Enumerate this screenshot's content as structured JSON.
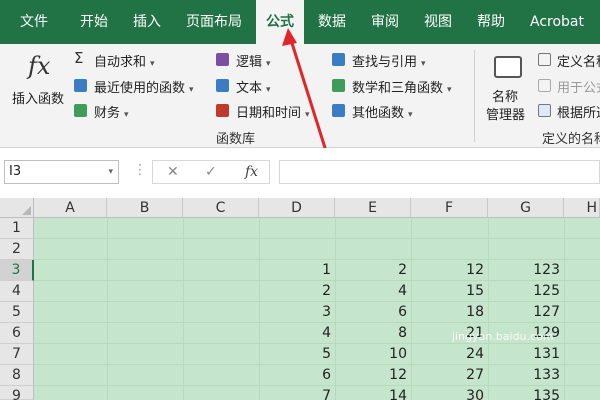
{
  "tabs": [
    "文件",
    "开始",
    "插入",
    "页面布局",
    "公式",
    "数据",
    "审阅",
    "视图",
    "帮助",
    "Acrobat"
  ],
  "active_tab": "公式",
  "ribbon": {
    "insert_function": "插入函数",
    "autosum": "自动求和",
    "recent": "最近使用的函数",
    "financial": "财务",
    "logical": "逻辑",
    "text": "文本",
    "datetime": "日期和时间",
    "lookup": "查找与引用",
    "math": "数学和三角函数",
    "more": "其他函数",
    "library_group": "函数库",
    "name_manager_line1": "名称",
    "name_manager_line2": "管理器",
    "define_name": "定义名称",
    "use_in_formula": "用于公式",
    "create_from_selection": "根据所选",
    "defined_names_group": "定义的名称",
    "fx_symbol": "fx",
    "sigma_symbol": "Σ"
  },
  "formula_bar": {
    "name_box": "I3",
    "cancel": "✕",
    "enter": "✓",
    "fx": "fx"
  },
  "grid": {
    "columns": [
      "A",
      "B",
      "C",
      "D",
      "E",
      "F",
      "G",
      "H"
    ],
    "rows": [
      "1",
      "2",
      "3",
      "4",
      "5",
      "6",
      "7",
      "8",
      "9"
    ],
    "selected_row": "3",
    "data": {
      "D": [
        "1",
        "2",
        "3",
        "4",
        "5",
        "6",
        "7"
      ],
      "E": [
        "2",
        "4",
        "6",
        "8",
        "10",
        "12",
        "14"
      ],
      "F": [
        "12",
        "15",
        "18",
        "21",
        "24",
        "27",
        "30"
      ],
      "G": [
        "123",
        "125",
        "127",
        "129",
        "131",
        "133",
        "135"
      ]
    }
  },
  "watermark": "jingyan.baidu.com",
  "colors": {
    "ribbon_green": "#217346",
    "cell_fill": "#c6e5cd",
    "arrow_red": "#e0262a"
  }
}
